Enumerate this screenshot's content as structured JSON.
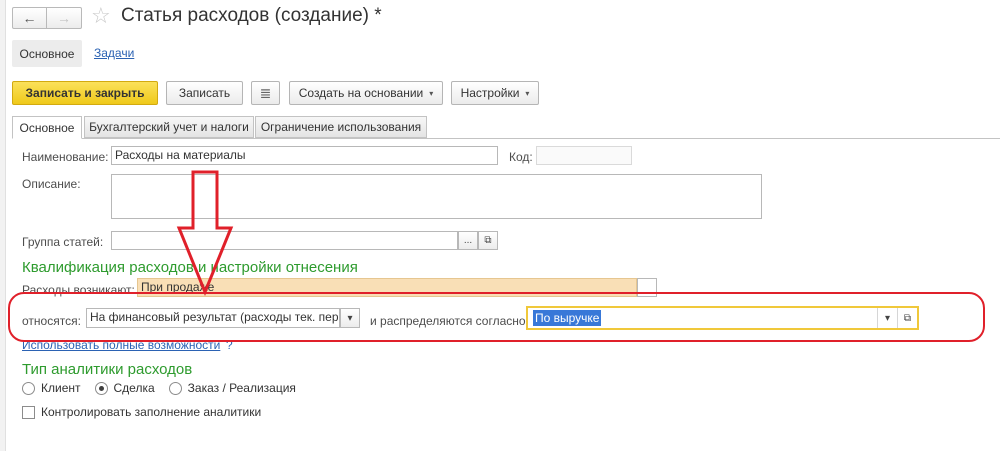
{
  "window": {
    "title": "Статья расходов (создание) *",
    "back_icon": "←",
    "forward_icon": "→",
    "star_icon": "☆"
  },
  "sections": {
    "main": "Основное",
    "tasks": "Задачи"
  },
  "toolbar": {
    "save_close": "Записать и закрыть",
    "save": "Записать",
    "report_icon": "≣",
    "create_based": "Создать на основании",
    "settings": "Настройки",
    "caret": "▾"
  },
  "tabs": [
    "Основное",
    "Бухгалтерский учет и налоги",
    "Ограничение использования"
  ],
  "form": {
    "name_label": "Наименование:",
    "name_value": "Расходы на материалы",
    "code_label": "Код:",
    "code_value": "",
    "desc_label": "Описание:",
    "desc_value": "",
    "group_label": "Группа статей:",
    "group_value": "",
    "select_dots": "...",
    "open_icon": "⧉",
    "dropdown_icon": "▾"
  },
  "qualification": {
    "title": "Квалификация расходов и настройки отнесения",
    "arise_label": "Расходы возникают:",
    "arise_value": "При продаже",
    "relate_label": "относятся:",
    "relate_value": "На финансовый результат (расходы тек. пери",
    "distribute_label": "и распределяются согласно:",
    "distribute_value": "По выручке",
    "full_link": "Использовать полные возможности",
    "help": "?"
  },
  "analytics": {
    "title": "Тип аналитики расходов",
    "options": [
      "Клиент",
      "Сделка",
      "Заказ / Реализация"
    ],
    "selected_index": 1,
    "control_label": "Контролировать заполнение аналитики",
    "control_checked": false
  },
  "colors": {
    "accent_green": "#2e9b2e",
    "primary_yellow": "#f5d327",
    "annotation_red": "#e0202a",
    "highlight": "#f9dfb6"
  }
}
